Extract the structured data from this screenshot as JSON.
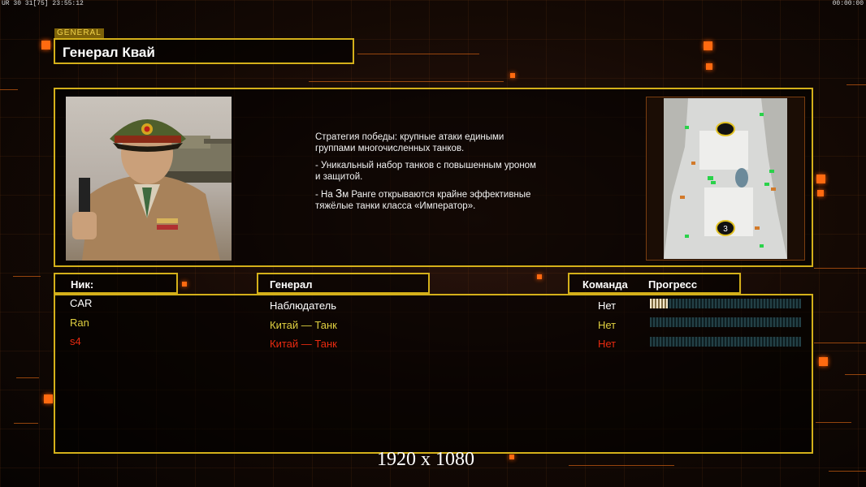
{
  "status": {
    "left": "UR 30 31[75] 23:55:12",
    "right": "00:00:00"
  },
  "general": {
    "tag": "GENERAL",
    "name": "Генерал Квай",
    "description": {
      "line1": "Стратегия победы: крупные атаки едиными",
      "line1b": " группами многочисленных танков.",
      "line2": "- Уникальный набор танков с повышенным уроном",
      "line2b": " и защитой.",
      "line3_pre": "- На ",
      "line3_num": "3",
      "line3_post": "м Ранге открываются крайне эффективные",
      "line3b": " тяжёлые танки класса «Император»."
    }
  },
  "minimap": {
    "marker_bottom": "3"
  },
  "headers": {
    "nick": "Ник:",
    "general": "Генерал",
    "team": "Команда",
    "progress": "Прогресс"
  },
  "players": [
    {
      "nick": "CAR",
      "general": "Наблюдатель",
      "team": "Нет",
      "color": "#ffffff",
      "progress": 0.12
    },
    {
      "nick": "Ran",
      "general": "Китай — Танк",
      "team": "Нет",
      "color": "#e0d040",
      "progress": 0
    },
    {
      "nick": "s4",
      "general": "Китай — Танк",
      "team": "Нет",
      "color": "#e82a10",
      "progress": 0
    }
  ],
  "resolution": "1920 x 1080"
}
